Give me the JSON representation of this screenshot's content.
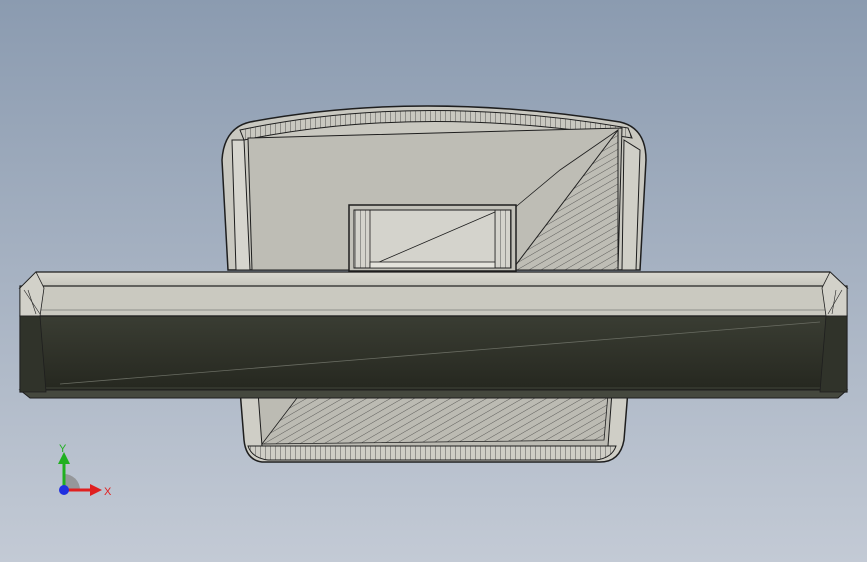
{
  "viewport": {
    "background_top": "#8b9bb0",
    "background_bottom": "#c3cad5"
  },
  "model": {
    "stroke": "#202020",
    "face_light": "#c8c7c0",
    "face_mid": "#b9b8b0",
    "face_dark": "#2a2c24"
  },
  "triad": {
    "x_label": "X",
    "y_label": "Y",
    "x_color": "#e02020",
    "y_color": "#20b020",
    "z_color": "#2030e0"
  }
}
